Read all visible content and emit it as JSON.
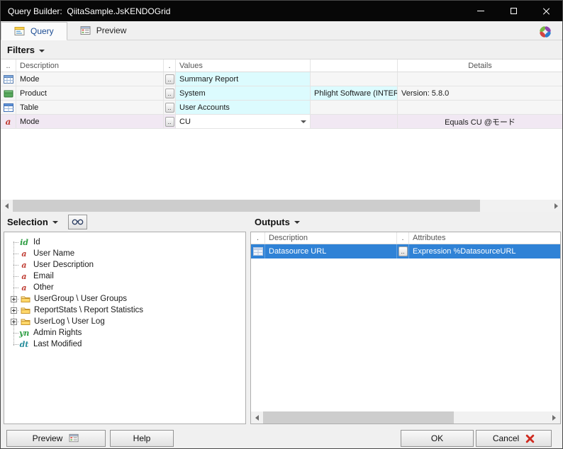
{
  "window": {
    "title": "Query Builder:  QiitaSample.JsKENDOGrid"
  },
  "tabs": [
    {
      "label": "Query"
    },
    {
      "label": "Preview"
    }
  ],
  "ui": {
    "ellipsis": ".."
  },
  "filters": {
    "title": "Filters",
    "columns": {
      "icon": "..",
      "description": "Description",
      "button": ".",
      "values": "Values",
      "extra": "",
      "details": "Details"
    },
    "rows": [
      {
        "description": "Mode",
        "value": "Summary Report",
        "extra": "",
        "details": ""
      },
      {
        "description": "Product",
        "value": "System",
        "extra": "Phlight Software (INTERNA...",
        "details": "Version: 5.8.0"
      },
      {
        "description": "Table",
        "value": "User Accounts",
        "extra": "",
        "details": ""
      },
      {
        "description": "Mode",
        "value": "CU",
        "extra": "",
        "details": "Equals CU @モード"
      }
    ]
  },
  "selection": {
    "title": "Selection",
    "tree": [
      {
        "glyph": "id",
        "label": "Id"
      },
      {
        "glyph": "a",
        "label": "User Name"
      },
      {
        "glyph": "a",
        "label": "User Description"
      },
      {
        "glyph": "a",
        "label": "Email"
      },
      {
        "glyph": "a",
        "label": "Other"
      },
      {
        "glyph": "",
        "label": "UserGroup \\ User Groups"
      },
      {
        "glyph": "",
        "label": "ReportStats \\ Report Statistics"
      },
      {
        "glyph": "",
        "label": "UserLog \\ User Log"
      },
      {
        "glyph": "yn",
        "label": "Admin Rights"
      },
      {
        "glyph": "dt",
        "label": "Last Modified"
      }
    ]
  },
  "outputs": {
    "title": "Outputs",
    "columns": {
      "icon": ".",
      "description": "Description",
      "button": ".",
      "attributes": "Attributes"
    },
    "rows": [
      {
        "description": "Datasource URL",
        "attributes": "Expression %DatasourceURL"
      }
    ]
  },
  "footer": {
    "preview": "Preview",
    "help": "Help",
    "ok": "OK",
    "cancel": "Cancel"
  }
}
